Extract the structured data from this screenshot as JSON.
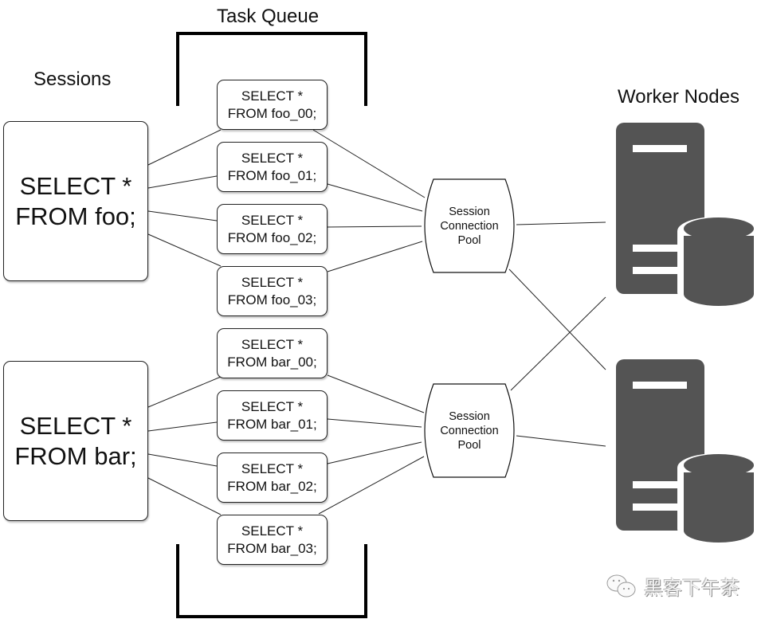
{
  "headings": {
    "task_queue": "Task Queue",
    "sessions": "Sessions",
    "worker_nodes": "Worker Nodes"
  },
  "sessions": [
    {
      "line1": "SELECT *",
      "line2": "FROM foo;"
    },
    {
      "line1": "SELECT *",
      "line2": "FROM bar;"
    }
  ],
  "tasks": [
    {
      "line1": "SELECT *",
      "line2": "FROM foo_00;"
    },
    {
      "line1": "SELECT *",
      "line2": "FROM foo_01;"
    },
    {
      "line1": "SELECT *",
      "line2": "FROM foo_02;"
    },
    {
      "line1": "SELECT *",
      "line2": "FROM foo_03;"
    },
    {
      "line1": "SELECT *",
      "line2": "FROM bar_00;"
    },
    {
      "line1": "SELECT *",
      "line2": "FROM bar_01;"
    },
    {
      "line1": "SELECT *",
      "line2": "FROM bar_02;"
    },
    {
      "line1": "SELECT *",
      "line2": "FROM bar_03;"
    }
  ],
  "pools": [
    {
      "line1": "Session",
      "line2": "Connection",
      "line3": "Pool"
    },
    {
      "line1": "Session",
      "line2": "Connection",
      "line3": "Pool"
    }
  ],
  "workers": [
    {
      "icon": "server-database-icon"
    },
    {
      "icon": "server-database-icon"
    }
  ],
  "watermark": {
    "icon": "wechat-icon",
    "text": "黑客下午茶"
  },
  "colors": {
    "server": "#545454",
    "line": "#222222"
  }
}
